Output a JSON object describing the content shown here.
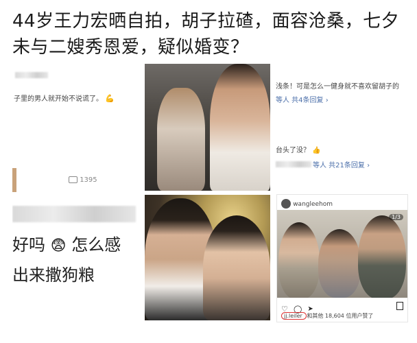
{
  "headline": "44岁王力宏晒自拍，胡子拉碴，面容沧桑，七夕未与二嫂秀恩爱，疑似婚变？",
  "left_top_card": {
    "comment": "子里的男人就开始不说谎了。",
    "emoji": "💪",
    "count": "1395"
  },
  "left_bottom_card": {
    "line1_a": "好吗",
    "emoji": "😨",
    "line1_b": "怎么感",
    "line2": "出来撒狗粮"
  },
  "right_top_card": {
    "line1": "浅条！可是怎么一健身就不喜欢留胡子的",
    "reply1": "等人 共4条回复",
    "line2": "台头了没？",
    "emoji2": "👍",
    "reply2": "等人 共21条回复"
  },
  "insta": {
    "username": "wangleehom",
    "page_indicator": "1/3",
    "likes_user": "jj.leiler",
    "likes_text": "和其他 18,604 位用户赞了"
  },
  "icons": [
    "comment-icon",
    "heart-icon",
    "send-icon",
    "bookmark-icon",
    "avatar-icon"
  ]
}
